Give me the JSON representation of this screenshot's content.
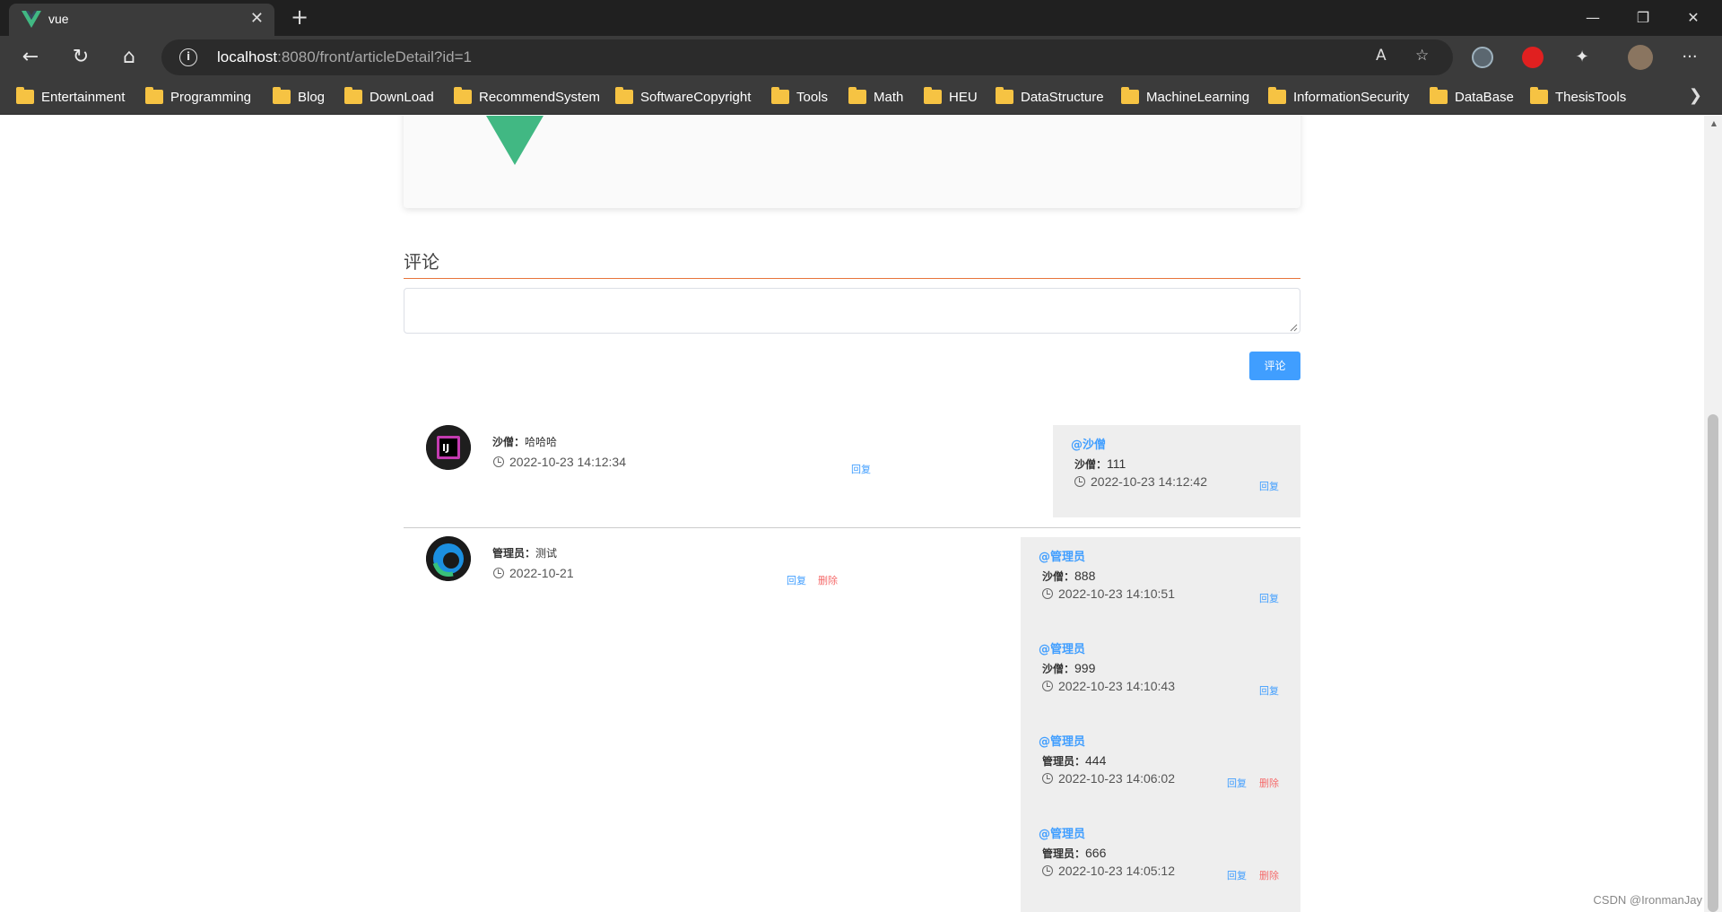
{
  "browser": {
    "tab_title": "vue",
    "url_host": "localhost",
    "url_rest": ":8080/front/articleDetail?id=1",
    "bookmarks": [
      "Entertainment",
      "Programming",
      "Blog",
      "DownLoad",
      "RecommendSystem",
      "SoftwareCopyright",
      "Tools",
      "Math",
      "HEU",
      "DataStructure",
      "MachineLearning",
      "InformationSecurity",
      "DataBase",
      "ThesisTools"
    ]
  },
  "comments": {
    "title": "评论",
    "input_value": "",
    "submit_label": "评论",
    "reply_label": "回复",
    "delete_label": "删除",
    "items": [
      {
        "author": "沙僧：",
        "content": "哈哈哈",
        "time": "2022-10-23 14:12:34",
        "replies": [
          {
            "at": "@沙僧",
            "author": "沙僧：",
            "content": "111",
            "time": "2022-10-23 14:12:42"
          }
        ]
      },
      {
        "author": "管理员：",
        "content": "测试",
        "time": "2022-10-21",
        "replies": [
          {
            "at": "@管理员",
            "author": "沙僧：",
            "content": "888",
            "time": "2022-10-23 14:10:51"
          },
          {
            "at": "@管理员",
            "author": "沙僧：",
            "content": "999",
            "time": "2022-10-23 14:10:43"
          },
          {
            "at": "@管理员",
            "author": "管理员：",
            "content": "444",
            "time": "2022-10-23 14:06:02"
          },
          {
            "at": "@管理员",
            "author": "管理员：",
            "content": "666",
            "time": "2022-10-23 14:05:12"
          }
        ]
      }
    ]
  },
  "watermark": "CSDN @IronmanJay"
}
